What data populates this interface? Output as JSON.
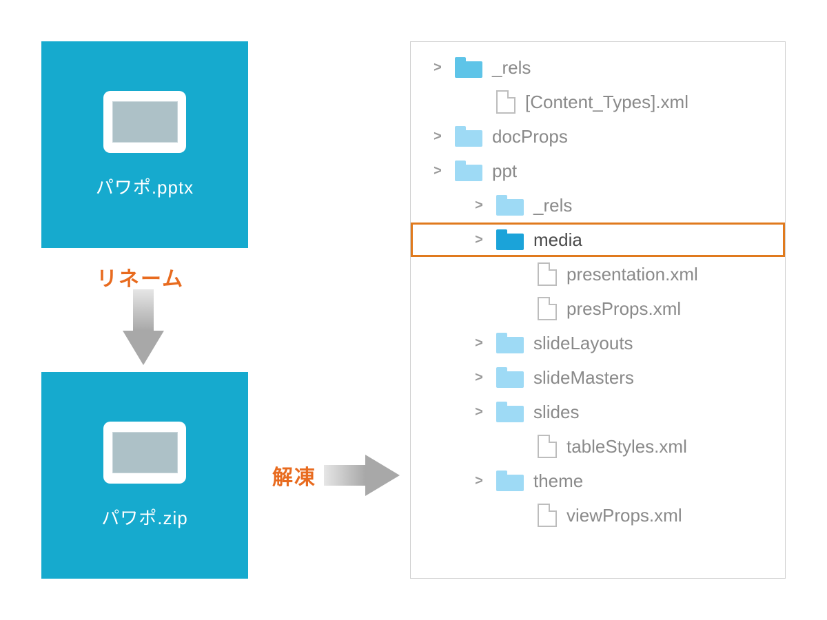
{
  "cards": {
    "top_label": "パワポ.pptx",
    "bottom_label": "パワポ.zip"
  },
  "labels": {
    "rename": "リネーム",
    "extract": "解凍"
  },
  "tree": [
    {
      "indent": 1,
      "type": "folder",
      "shade": "mid",
      "expandable": true,
      "label": "_rels"
    },
    {
      "indent": 2,
      "type": "file",
      "expandable": false,
      "label": "[Content_Types].xml"
    },
    {
      "indent": 1,
      "type": "folder",
      "shade": "light",
      "expandable": true,
      "label": "docProps"
    },
    {
      "indent": 1,
      "type": "folder",
      "shade": "light",
      "expandable": true,
      "label": "ppt"
    },
    {
      "indent": 2,
      "type": "folder",
      "shade": "light",
      "expandable": true,
      "label": "_rels"
    },
    {
      "indent": 2,
      "type": "folder",
      "shade": "dark",
      "expandable": true,
      "label": "media",
      "highlight": true
    },
    {
      "indent": 3,
      "type": "file",
      "expandable": false,
      "label": "presentation.xml"
    },
    {
      "indent": 3,
      "type": "file",
      "expandable": false,
      "label": "presProps.xml"
    },
    {
      "indent": 2,
      "type": "folder",
      "shade": "light",
      "expandable": true,
      "label": "slideLayouts"
    },
    {
      "indent": 2,
      "type": "folder",
      "shade": "light",
      "expandable": true,
      "label": "slideMasters"
    },
    {
      "indent": 2,
      "type": "folder",
      "shade": "light",
      "expandable": true,
      "label": "slides"
    },
    {
      "indent": 3,
      "type": "file",
      "expandable": false,
      "label": "tableStyles.xml"
    },
    {
      "indent": 2,
      "type": "folder",
      "shade": "light",
      "expandable": true,
      "label": "theme"
    },
    {
      "indent": 3,
      "type": "file",
      "expandable": false,
      "label": "viewProps.xml"
    }
  ]
}
